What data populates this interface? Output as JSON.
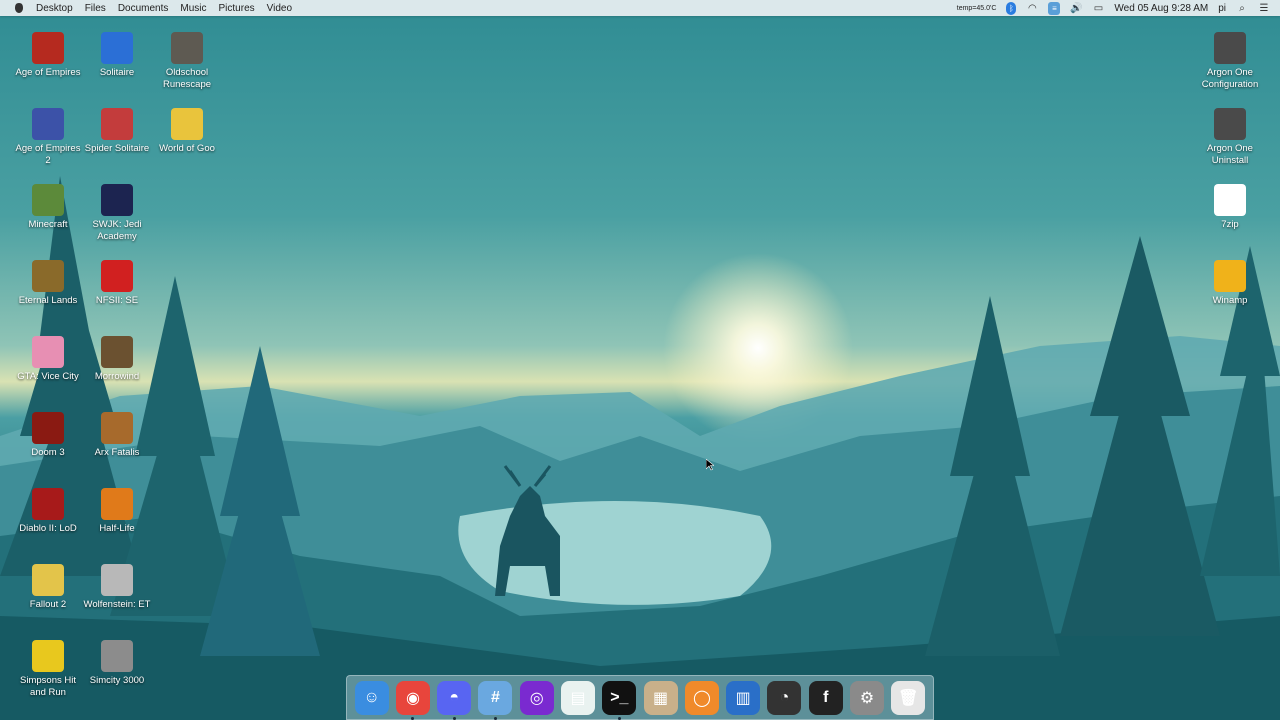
{
  "menubar": {
    "items": [
      "Desktop",
      "Files",
      "Documents",
      "Music",
      "Pictures",
      "Video"
    ],
    "temp": "temp=45.0'C",
    "datetime": "Wed 05 Aug  9:28 AM",
    "user": "pi",
    "status_icons": [
      "bluetooth-icon",
      "wifi-icon",
      "audio-volume-icon",
      "battery-icon",
      "search-icon",
      "list-icon"
    ]
  },
  "desktop_left": [
    {
      "label": "Age of Empires",
      "icon": "age-of-empires-icon",
      "color": "#b52a1f"
    },
    {
      "label": "Solitaire",
      "icon": "solitaire-icon",
      "color": "#2b6fd6"
    },
    {
      "label": "Oldschool Runescape",
      "icon": "runescape-icon",
      "color": "#5e5a52"
    },
    {
      "label": "Age of Empires 2",
      "icon": "age-of-empires-2-icon",
      "color": "#3c52a8"
    },
    {
      "label": "Spider Solitaire",
      "icon": "spider-solitaire-icon",
      "color": "#c33c3c"
    },
    {
      "label": "World of Goo",
      "icon": "world-of-goo-icon",
      "color": "#e9c43c"
    },
    {
      "label": "Minecraft",
      "icon": "minecraft-icon",
      "color": "#5c8a3a"
    },
    {
      "label": "SWJK: Jedi Academy",
      "icon": "jedi-academy-icon",
      "color": "#1c2450"
    },
    {
      "label": "Eternal Lands",
      "icon": "eternal-lands-icon",
      "color": "#8a6a2a"
    },
    {
      "label": "NFSII: SE",
      "icon": "nfsii-icon",
      "color": "#d12020"
    },
    {
      "label": "GTA: Vice City",
      "icon": "gta-vice-city-icon",
      "color": "#e78fb3"
    },
    {
      "label": "Morrowind",
      "icon": "morrowind-icon",
      "color": "#6b5130"
    },
    {
      "label": "Doom 3",
      "icon": "doom-3-icon",
      "color": "#8a1a12"
    },
    {
      "label": "Arx Fatalis",
      "icon": "arx-fatalis-icon",
      "color": "#a76a2c"
    },
    {
      "label": "Diablo II: LoD",
      "icon": "diablo-icon",
      "color": "#a71a1a"
    },
    {
      "label": "Half-Life",
      "icon": "half-life-icon",
      "color": "#e07a1a"
    },
    {
      "label": "Fallout 2",
      "icon": "fallout-icon",
      "color": "#e3c44a"
    },
    {
      "label": "Wolfenstein: ET",
      "icon": "wolfenstein-icon",
      "color": "#b8b8b8"
    },
    {
      "label": "Simpsons Hit and Run",
      "icon": "simpsons-icon",
      "color": "#e8c81e"
    },
    {
      "label": "Simcity 3000",
      "icon": "simcity-icon",
      "color": "#8c8c8c"
    }
  ],
  "desktop_right": [
    {
      "label": "Argon One Configuration",
      "icon": "argon-config-icon",
      "color": "#4a4a4a"
    },
    {
      "label": "Argon One Uninstall",
      "icon": "argon-uninstall-icon",
      "color": "#4a4a4a"
    },
    {
      "label": "7zip",
      "icon": "7zip-icon",
      "color": "#ffffff"
    },
    {
      "label": "Winamp",
      "icon": "winamp-icon",
      "color": "#f0b21a"
    }
  ],
  "dock": [
    {
      "icon": "finder-icon",
      "color": "#3a8de0",
      "glyph": "☺",
      "running": false
    },
    {
      "icon": "chrome-icon",
      "color": "#e8453c",
      "glyph": "◉",
      "running": true
    },
    {
      "icon": "discord-icon",
      "color": "#5865f2",
      "glyph": "◓",
      "running": true
    },
    {
      "icon": "hash-chat-icon",
      "color": "#6aa8e0",
      "glyph": "#",
      "running": true
    },
    {
      "icon": "podcast-icon",
      "color": "#7a2ad0",
      "glyph": "◎",
      "running": false
    },
    {
      "icon": "book-reader-icon",
      "color": "#e9f2f0",
      "glyph": "▤",
      "running": false
    },
    {
      "icon": "terminal-icon",
      "color": "#111111",
      "glyph": ">_",
      "running": true
    },
    {
      "icon": "video-editor-icon",
      "color": "#c9b08a",
      "glyph": "▦",
      "running": false
    },
    {
      "icon": "media-player-icon",
      "color": "#f08a2a",
      "glyph": "◯",
      "running": false
    },
    {
      "icon": "text-editor-icon",
      "color": "#2a6fc8",
      "glyph": "▥",
      "running": false
    },
    {
      "icon": "obs-icon",
      "color": "#333333",
      "glyph": "◔",
      "running": false
    },
    {
      "icon": "font-app-icon",
      "color": "#222222",
      "glyph": "f",
      "running": false
    },
    {
      "icon": "system-preferences-icon",
      "color": "#8a8a8a",
      "glyph": "⚙",
      "running": false
    },
    {
      "icon": "trash-icon",
      "color": "#e6e6e6",
      "glyph": "🗑",
      "running": false
    }
  ]
}
